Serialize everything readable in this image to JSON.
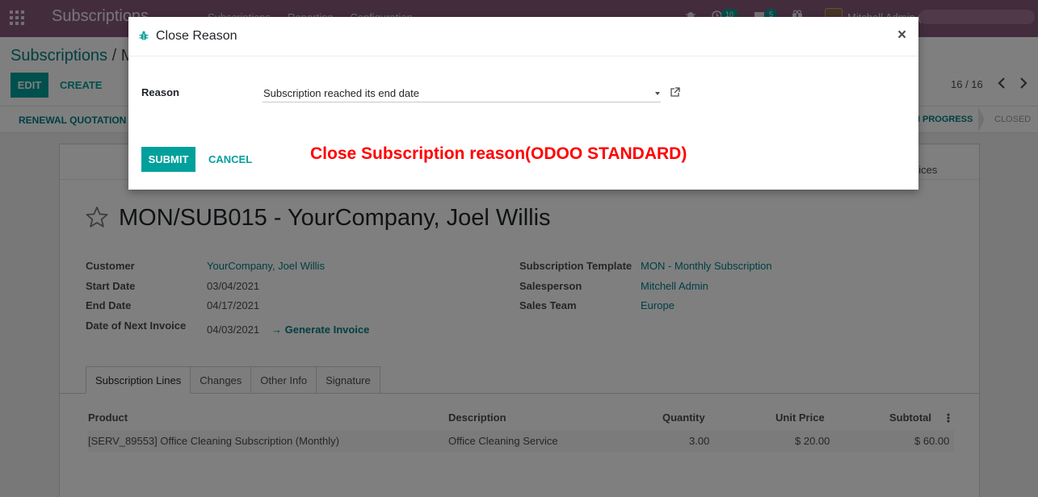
{
  "navbar": {
    "app_name": "Subscriptions",
    "menu": [
      "Subscriptions",
      "Reporting",
      "Configuration"
    ],
    "activity_badge": "10",
    "messages_badge": "5",
    "user_name": "Mitchell Admin ("
  },
  "control_panel": {
    "breadcrumb_root": "Subscriptions",
    "breadcrumb_sep": "/",
    "breadcrumb_current": "M-",
    "edit_label": "EDIT",
    "create_label": "CREATE",
    "pager": "16 / 16"
  },
  "statusbar": {
    "renewal_label": "RENEWAL QUOTATION",
    "stage_current": "N PROGRESS",
    "stage_closed": "CLOSED"
  },
  "sheet": {
    "invoices_label": "oices",
    "title": "MON/SUB015 - YourCompany, Joel Willis",
    "left_fields": [
      {
        "label": "Customer",
        "value": "YourCompany, Joel Willis"
      },
      {
        "label": "Start Date",
        "value": "03/04/2021"
      },
      {
        "label": "End Date",
        "value": "04/17/2021"
      },
      {
        "label": "Date of Next Invoice",
        "value": "04/03/2021"
      }
    ],
    "generate_invoice": "→ Generate Invoice",
    "right_fields": [
      {
        "label": "Subscription Template",
        "value": "MON - Monthly Subscription"
      },
      {
        "label": "Salesperson",
        "value": "Mitchell Admin"
      },
      {
        "label": "Sales Team",
        "value": "Europe"
      }
    ],
    "tabs": [
      "Subscription Lines",
      "Changes",
      "Other Info",
      "Signature"
    ],
    "lines_columns": [
      "Product",
      "Description",
      "Quantity",
      "Unit Price",
      "Subtotal"
    ],
    "lines_rows": [
      {
        "product": "[SERV_89553] Office Cleaning Subscription (Monthly)",
        "description": "Office Cleaning Service",
        "quantity": "3.00",
        "unit_price": "$ 20.00",
        "subtotal": "$ 60.00"
      }
    ]
  },
  "modal": {
    "title": "Close Reason",
    "close_symbol": "×",
    "reason_label": "Reason",
    "reason_value": "Subscription reached its end date",
    "submit_label": "SUBMIT",
    "cancel_label": "CANCEL"
  },
  "annotation": "Close Subscription reason(ODOO STANDARD)",
  "colors": {
    "navbar": "#875a7b",
    "primary": "#00a09d",
    "link": "#017e84",
    "annotation": "#ff0000"
  },
  "icons": [
    "apps-grid-icon",
    "bug-icon",
    "star-icon",
    "external-link-icon",
    "chevron-left-icon",
    "chevron-right-icon",
    "kebab-icon",
    "clock-icon",
    "chat-icon",
    "gift-icon"
  ]
}
